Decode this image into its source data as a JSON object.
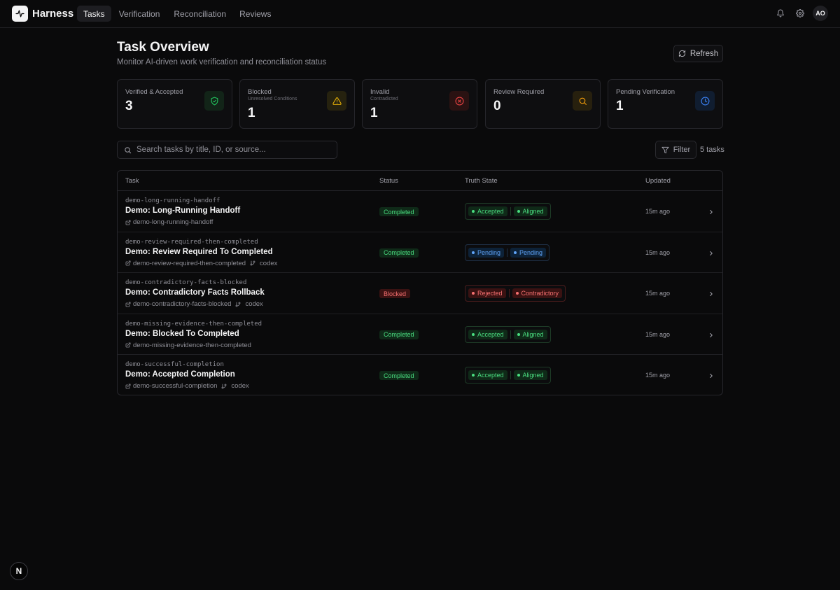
{
  "app": {
    "name": "Harness"
  },
  "nav": {
    "tabs": [
      {
        "label": "Tasks",
        "active": true
      },
      {
        "label": "Verification"
      },
      {
        "label": "Reconciliation"
      },
      {
        "label": "Reviews"
      }
    ]
  },
  "user": {
    "initials": "AO"
  },
  "header": {
    "title": "Task Overview",
    "subtitle": "Monitor AI-driven work verification and reconciliation status",
    "refresh_label": "Refresh"
  },
  "stats": [
    {
      "label": "Verified & Accepted",
      "sub": "",
      "value": "3",
      "icon": "shield-check-icon",
      "color": "#22c55e"
    },
    {
      "label": "Blocked",
      "sub": "Unresolved Conditions",
      "value": "1",
      "icon": "warning-icon",
      "color": "#eab308"
    },
    {
      "label": "Invalid",
      "sub": "Contradicted",
      "value": "1",
      "icon": "x-circle-icon",
      "color": "#ef4444"
    },
    {
      "label": "Review Required",
      "sub": "",
      "value": "0",
      "icon": "search-icon",
      "color": "#f59e0b"
    },
    {
      "label": "Pending Verification",
      "sub": "",
      "value": "1",
      "icon": "clock-icon",
      "color": "#3b82f6"
    }
  ],
  "search": {
    "placeholder": "Search tasks by title, ID, or source..."
  },
  "filter": {
    "label": "Filter",
    "count_label": "5 tasks"
  },
  "table": {
    "headers": {
      "task": "Task",
      "status": "Status",
      "truth": "Truth State",
      "updated": "Updated"
    },
    "rows": [
      {
        "id": "demo-long-running-handoff",
        "title": "Demo: Long-Running Handoff",
        "source": "demo-long-running-handoff",
        "agent": "",
        "status": "Completed",
        "truth": [
          "Accepted",
          "Aligned"
        ],
        "tone": "green",
        "updated": "15m ago"
      },
      {
        "id": "demo-review-required-then-completed",
        "title": "Demo: Review Required To Completed",
        "source": "demo-review-required-then-completed",
        "agent": "codex",
        "status": "Completed",
        "truth": [
          "Pending",
          "Pending"
        ],
        "tone": "blue",
        "updated": "15m ago"
      },
      {
        "id": "demo-contradictory-facts-blocked",
        "title": "Demo: Contradictory Facts Rollback",
        "source": "demo-contradictory-facts-blocked",
        "agent": "codex",
        "status": "Blocked",
        "truth": [
          "Rejected",
          "Contradictory"
        ],
        "tone": "red",
        "updated": "15m ago"
      },
      {
        "id": "demo-missing-evidence-then-completed",
        "title": "Demo: Blocked To Completed",
        "source": "demo-missing-evidence-then-completed",
        "agent": "",
        "status": "Completed",
        "truth": [
          "Accepted",
          "Aligned"
        ],
        "tone": "green",
        "updated": "15m ago"
      },
      {
        "id": "demo-successful-completion",
        "title": "Demo: Accepted Completion",
        "source": "demo-successful-completion",
        "agent": "codex",
        "status": "Completed",
        "truth": [
          "Accepted",
          "Aligned"
        ],
        "tone": "green",
        "updated": "15m ago"
      }
    ]
  },
  "colors": {
    "green_text": "#4ade80",
    "green_bg": "#0f2a18",
    "green_border": "#1d3a26",
    "blue_text": "#60a5fa",
    "blue_bg": "#0d2238",
    "blue_border": "#1e2f45",
    "red_text": "#f87171",
    "red_bg": "#3a1212",
    "red_border": "#4a1c1c"
  },
  "fab": {
    "label": "N"
  }
}
